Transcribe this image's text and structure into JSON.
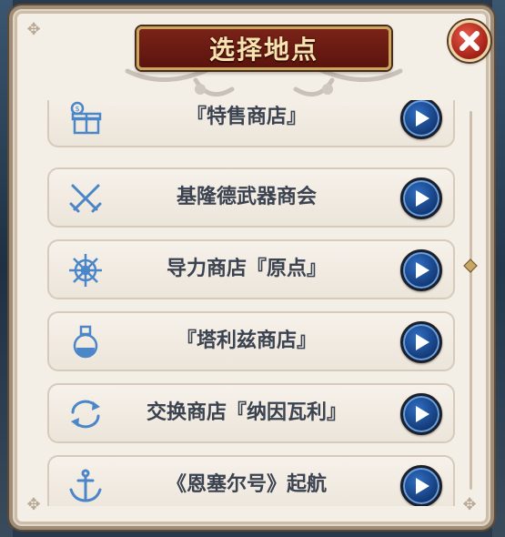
{
  "dialog": {
    "title": "选择地点",
    "close_icon": "close-icon",
    "items": [
      {
        "label": "『特售商店』",
        "icon": "gift-icon"
      },
      {
        "label": "基隆德武器商会",
        "icon": "crossed-swords-icon"
      },
      {
        "label": "导力商店『原点』",
        "icon": "ship-wheel-icon"
      },
      {
        "label": "『塔利兹商店』",
        "icon": "potion-flask-icon"
      },
      {
        "label": "交换商店『纳因瓦利』",
        "icon": "exchange-arrows-icon"
      },
      {
        "label": "《恩塞尔号》起航",
        "icon": "anchor-icon"
      }
    ],
    "go_button_icon": "play-icon"
  },
  "colors": {
    "banner": "#6a1b12",
    "banner_text": "#f7e3b0",
    "panel": "#f3eee6",
    "item_text": "#3b4250",
    "icon_blue": "#4a86c8",
    "button_blue": "#1c4f9a",
    "close_red": "#c0352a"
  }
}
